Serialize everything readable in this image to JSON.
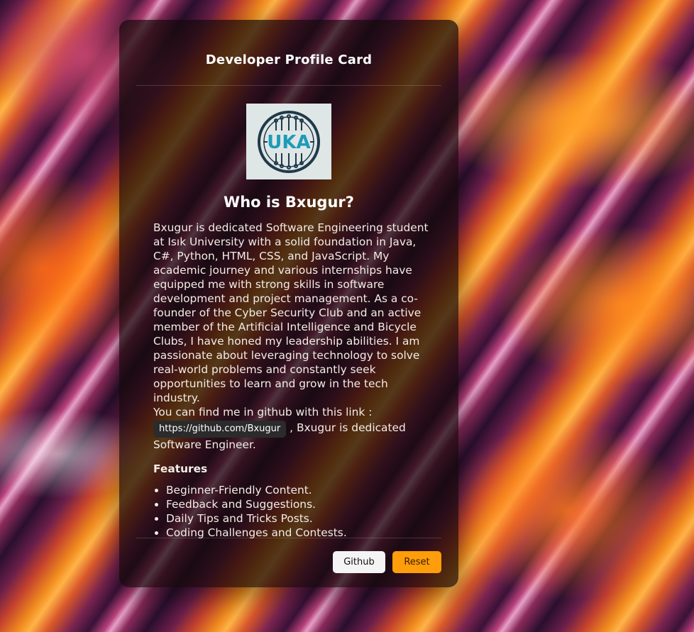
{
  "card": {
    "title": "Developer Profile Card"
  },
  "logo": {
    "text": "UKA",
    "icon": "circuit-logo-icon"
  },
  "profile": {
    "heading": "Who is Bxugur?",
    "bio": "Bxugur is dedicated Software Engineering student at Isık University with a solid foundation in Java, C#, Python, HTML, CSS, and JavaScript. My academic journey and various internships have equipped me with strong skills in software development and project management. As a co-founder of the Cyber Security Club and an active member of the Artificial Intelligence and Bicycle Clubs, I have honed my leadership abilities. I am passionate about leveraging technology to solve real-world problems and constantly seek opportunities to learn and grow in the tech industry.",
    "link_intro": "You can find me in github with this link :",
    "link_text": "https://github.com/Bxugur",
    "link_suffix": ", Bxugur is dedicated Software Engineer."
  },
  "features": {
    "title": "Features",
    "items": [
      "Beginner-Friendly Content.",
      "Feedback and Suggestions.",
      "Daily Tips and Tricks Posts.",
      "Coding Challenges and Contests."
    ]
  },
  "buttons": {
    "github": "Github",
    "reset": "Reset"
  },
  "colors": {
    "accent": "#ff9d0a",
    "logo_teal": "#1e9bb8",
    "logo_dark": "#1f3a4a"
  }
}
